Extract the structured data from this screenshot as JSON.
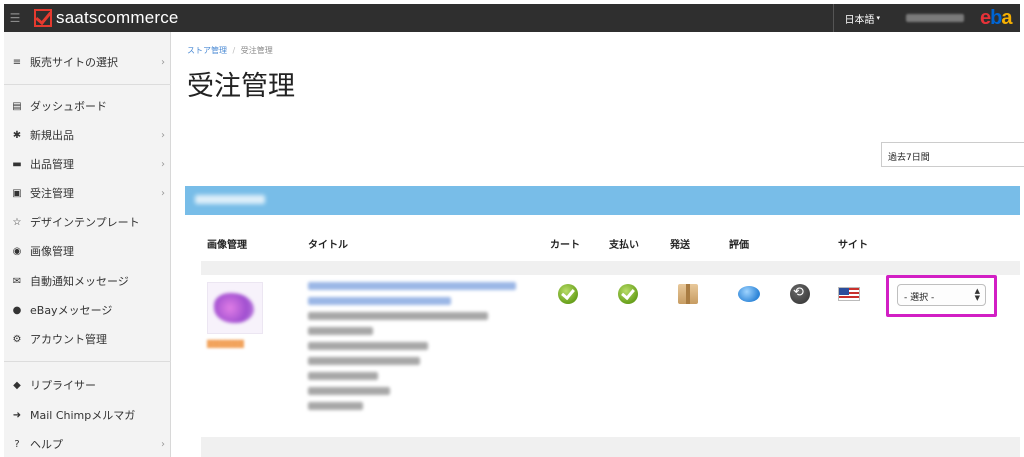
{
  "header": {
    "logo_text": "saatscommerce",
    "language": "日本語",
    "caret": "▾",
    "ebay_partial": [
      "e",
      "b",
      "a"
    ],
    "menu_icon": "hamburger-icon"
  },
  "sidebar": {
    "items": [
      {
        "icon": "≡",
        "icon_name": "list-icon",
        "label": "販売サイトの選択",
        "arrow": "›"
      },
      {
        "icon": "▤",
        "icon_name": "dashboard-chart-icon",
        "label": "ダッシュボード",
        "arrow": ""
      },
      {
        "icon": "✱",
        "icon_name": "asterisk-icon",
        "label": "新規出品",
        "arrow": "›"
      },
      {
        "icon": "▬",
        "icon_name": "archive-icon",
        "label": "出品管理",
        "arrow": "›"
      },
      {
        "icon": "▣",
        "icon_name": "order-icon",
        "label": "受注管理",
        "arrow": "›"
      },
      {
        "icon": "☆",
        "icon_name": "magic-star-icon",
        "label": "デザインテンプレート",
        "arrow": ""
      },
      {
        "icon": "◉",
        "icon_name": "camera-icon",
        "label": "画像管理",
        "arrow": ""
      },
      {
        "icon": "✉",
        "icon_name": "envelope-icon",
        "label": "自動通知メッセージ",
        "arrow": ""
      },
      {
        "icon": "●",
        "icon_name": "chat-bubble-icon",
        "label": "eBayメッセージ",
        "arrow": ""
      },
      {
        "icon": "⚙",
        "icon_name": "gears-icon",
        "label": "アカウント管理",
        "arrow": ""
      },
      {
        "icon": "◆",
        "icon_name": "tag-icon",
        "label": "リプライサー",
        "arrow": ""
      },
      {
        "icon": "➜",
        "icon_name": "sign-in-icon",
        "label": "Mail Chimpメルマガ",
        "arrow": ""
      },
      {
        "icon": "?",
        "icon_name": "help-icon",
        "label": "ヘルプ",
        "arrow": "›"
      }
    ]
  },
  "breadcrumb": {
    "store": "ストア管理",
    "sep": "/",
    "current": "受注管理"
  },
  "page_title": "受注管理",
  "period_filter": "過去7日間",
  "table": {
    "headers": [
      "画像管理",
      "タイトル",
      "カート",
      "支払い",
      "発送",
      "評価",
      "サイト"
    ],
    "row": {
      "select_value": "- 選択 -",
      "status_icons": [
        "check-icon",
        "check-icon",
        "package-icon",
        "feedback-bubble-icon",
        "reply-icon",
        "us-flag-icon"
      ]
    }
  },
  "colors": {
    "highlight": "#d21fc4",
    "band": "#78bde8",
    "topbar": "#2f2f2f"
  }
}
